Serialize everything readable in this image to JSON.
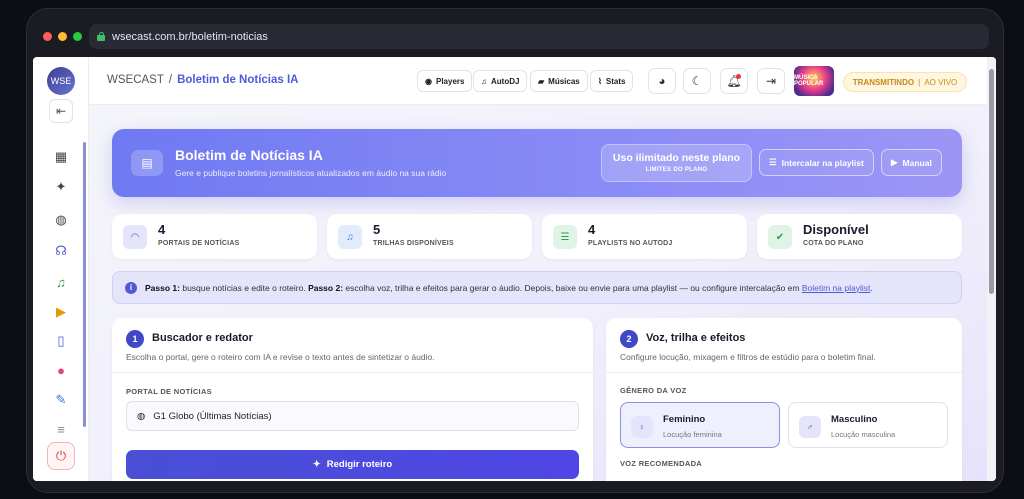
{
  "browser": {
    "url": "wsecast.com.br/boletim-noticias",
    "dots": [
      "#ff5f57",
      "#febc2e",
      "#28c840"
    ]
  },
  "sidebar": {
    "logo_text": "WSE",
    "items": [
      {
        "icon": "dashboard-icon",
        "glyph": "▦",
        "color": "#444"
      },
      {
        "icon": "magic-wand-icon",
        "glyph": "✦",
        "color": "#444"
      },
      {
        "icon": "globe-icon",
        "glyph": "◍",
        "color": "#444"
      },
      {
        "icon": "headphones-icon",
        "glyph": "☊",
        "color": "#4f5bd5"
      },
      {
        "icon": "music-icon",
        "glyph": "♫",
        "color": "#2e9e4f"
      },
      {
        "icon": "play-circle-icon",
        "glyph": "▶",
        "color": "#e59a00"
      },
      {
        "icon": "mobile-icon",
        "glyph": "▯",
        "color": "#4f5bd5"
      },
      {
        "icon": "users-icon",
        "glyph": "●",
        "color": "#e0457b"
      },
      {
        "icon": "wrench-icon",
        "glyph": "✎",
        "color": "#3a7bd5"
      },
      {
        "icon": "sliders-icon",
        "glyph": "≡",
        "color": "#888"
      }
    ]
  },
  "header": {
    "brand": "WSECAST",
    "separator": "/",
    "page": "Boletim de Notícias IA",
    "buttons": [
      {
        "label": "Players",
        "glyph": "◉"
      },
      {
        "label": "AutoDJ",
        "glyph": "♫"
      },
      {
        "label": "Músicas",
        "glyph": "▰"
      },
      {
        "label": "Stats",
        "glyph": "⌇"
      }
    ],
    "avatar_text": "MÚSICA POPULAR",
    "live_label": "TRANSMITINDO",
    "live_sep": "|",
    "live_state": "AO VIVO"
  },
  "hero": {
    "title": "Boletim de Notícias IA",
    "subtitle": "Gere e publique boletins jornalísticos atualizados em áudio na sua rádio",
    "plan_main": "Uso ilimitado neste plano",
    "plan_sub": "LIMITES DO PLANO",
    "btn_playlist": "Intercalar na playlist",
    "btn_manual": "Manual"
  },
  "stats": [
    {
      "value": "4",
      "label": "PORTAIS DE NOTÍCIAS",
      "icon": "rss-icon",
      "glyph": "◠",
      "bg": "#e4e4fb",
      "fg": "#4f5bd5"
    },
    {
      "value": "5",
      "label": "TRILHAS DISPONÍVEIS",
      "icon": "music-note-icon",
      "glyph": "♫",
      "bg": "#e1ecfb",
      "fg": "#3a7bd5"
    },
    {
      "value": "4",
      "label": "PLAYLISTS NO AUTODJ",
      "icon": "list-icon",
      "glyph": "☰",
      "bg": "#dff4e7",
      "fg": "#2e9e4f"
    },
    {
      "value": "Disponível",
      "label": "COTA DO PLANO",
      "icon": "check-circle-icon",
      "glyph": "✔",
      "bg": "#dff4e7",
      "fg": "#2e9e4f"
    }
  ],
  "info": {
    "step1_label": "Passo 1:",
    "step1_text": "busque notícias e edite o roteiro.",
    "step2_label": "Passo 2:",
    "step2_text": "escolha voz, trilha e efeitos para gerar o áudio. Depois, baixe ou envie para uma playlist — ou configure intercalação em",
    "link": "Boletim na playlist",
    "end": "."
  },
  "card1": {
    "number": "1",
    "title": "Buscador e redator",
    "subtitle": "Escolha o portal, gere o roteiro com IA e revise o texto antes de sintetizar o áudio.",
    "portal_label": "PORTAL DE NOTÍCIAS",
    "portal_value": "G1 Globo (Últimas Notícias)",
    "button": "Redigir roteiro"
  },
  "card2": {
    "number": "2",
    "title": "Voz, trilha e efeitos",
    "subtitle": "Configure locução, mixagem e filtros de estúdio para o boletim final.",
    "gender_label": "GÊNERO DA VOZ",
    "female_title": "Feminino",
    "female_sub": "Locução feminina",
    "male_title": "Masculino",
    "male_sub": "Locução masculina",
    "voice_label": "VOZ RECOMENDADA"
  }
}
